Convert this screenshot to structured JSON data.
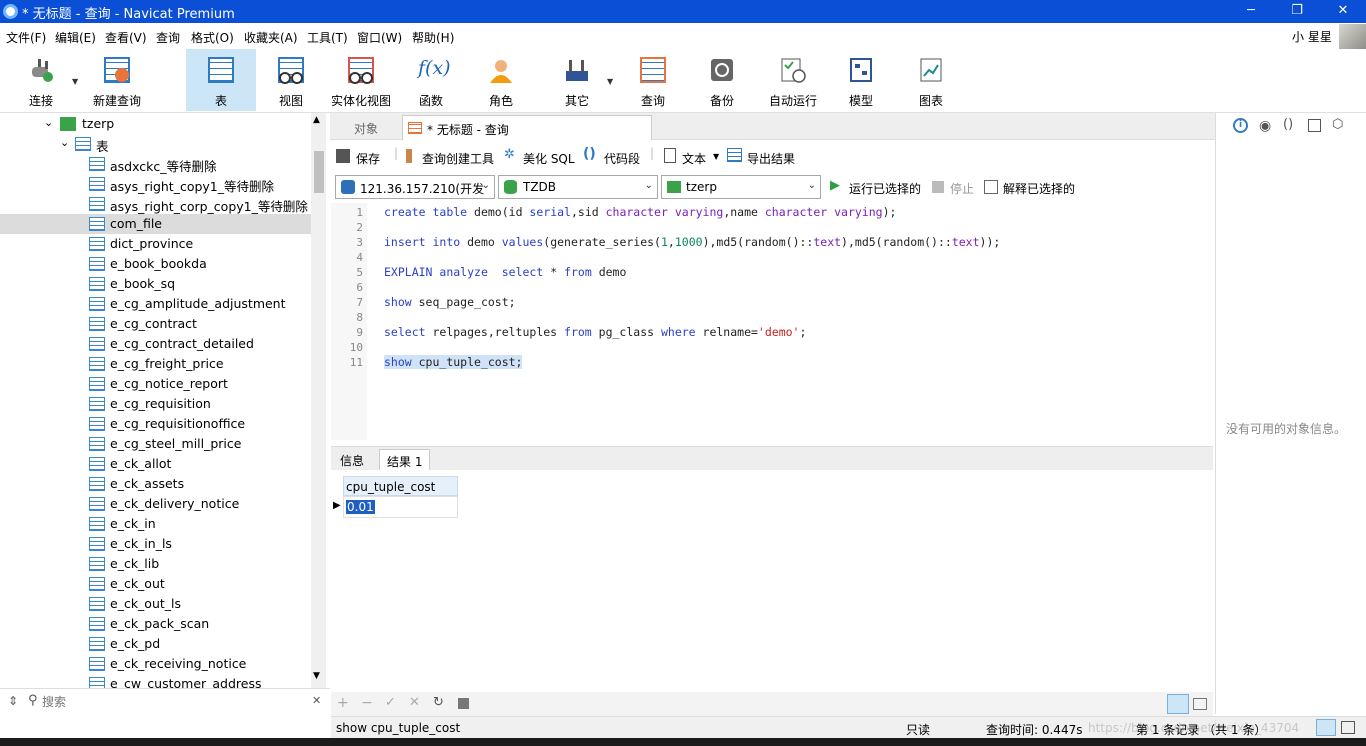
{
  "window": {
    "title": "* 无标题 - 查询 - Navicat Premium",
    "min": "─",
    "max": "❐",
    "close": "✕"
  },
  "menu": [
    "文件(F)",
    "编辑(E)",
    "查看(V)",
    "查询",
    "格式(O)",
    "收藏夹(A)",
    "工具(T)",
    "窗口(W)",
    "帮助(H)"
  ],
  "user": "小 星星",
  "toolbar": [
    {
      "label": "连接",
      "icon": "plug-icon"
    },
    {
      "label": "新建查询",
      "icon": "new-query-icon"
    },
    {
      "label": "表",
      "icon": "table-icon",
      "active": true
    },
    {
      "label": "视图",
      "icon": "view-icon"
    },
    {
      "label": "实体化视图",
      "icon": "materialized-view-icon"
    },
    {
      "label": "函数",
      "icon": "function-icon",
      "glyph": "f(x)"
    },
    {
      "label": "角色",
      "icon": "role-icon"
    },
    {
      "label": "其它",
      "icon": "tools-icon"
    },
    {
      "label": "查询",
      "icon": "query-icon"
    },
    {
      "label": "备份",
      "icon": "backup-icon"
    },
    {
      "label": "自动运行",
      "icon": "automation-icon"
    },
    {
      "label": "模型",
      "icon": "model-icon"
    },
    {
      "label": "图表",
      "icon": "chart-icon"
    }
  ],
  "tree": {
    "db": "tzerp",
    "folder": "表",
    "items": [
      "asdxckc_等待删除",
      "asys_right_copy1_等待删除",
      "asys_right_corp_copy1_等待删除",
      "com_file",
      "dict_province",
      "e_book_bookda",
      "e_book_sq",
      "e_cg_amplitude_adjustment",
      "e_cg_contract",
      "e_cg_contract_detailed",
      "e_cg_freight_price",
      "e_cg_notice_report",
      "e_cg_requisition",
      "e_cg_requisitionoffice",
      "e_cg_steel_mill_price",
      "e_ck_allot",
      "e_ck_assets",
      "e_ck_delivery_notice",
      "e_ck_in",
      "e_ck_in_ls",
      "e_ck_lib",
      "e_ck_out",
      "e_ck_out_ls",
      "e_ck_pack_scan",
      "e_ck_pd",
      "e_ck_receiving_notice",
      "e_cw_customer_address"
    ],
    "selected_index": 3,
    "search_placeholder": "搜索"
  },
  "tabs": {
    "objects": "对象",
    "query": "* 无标题 - 查询"
  },
  "query_toolbar": {
    "save": "保存",
    "builder": "查询创建工具",
    "beautify": "美化 SQL",
    "snippet": "代码段",
    "text": "文本",
    "export": "导出结果"
  },
  "combos": {
    "connection": "121.36.157.210(开发",
    "database": "TZDB",
    "schema": "tzerp"
  },
  "actions": {
    "run_selected": "运行已选择的",
    "stop": "停止",
    "explain_selected": "解释已选择的"
  },
  "editor": {
    "line_numbers": [
      "1",
      "2",
      "3",
      "4",
      "5",
      "6",
      "7",
      "8",
      "9",
      "10",
      "11"
    ],
    "lines": [
      "create table demo(id serial,sid character varying,name character varying);",
      "",
      "insert into demo values(generate_series(1,1000),md5(random()::text),md5(random()::text));",
      "",
      "EXPLAIN analyze  select * from demo",
      "",
      "show seq_page_cost;",
      "",
      "select relpages,reltuples from pg_class where relname='demo';",
      "",
      "show cpu_tuple_cost;"
    ]
  },
  "result_tabs": {
    "info": "信息",
    "result": "结果 1"
  },
  "result": {
    "columns": [
      "cpu_tuple_cost"
    ],
    "rows": [
      [
        "0.01"
      ]
    ]
  },
  "right_panel": {
    "empty": "没有可用的对象信息。"
  },
  "status": {
    "sql": "show cpu_tuple_cost",
    "mode": "只读",
    "time": "查询时间: 0.447s",
    "records": "第 1 条记录 （共 1 条）",
    "watermark": "https://blog.csdn.net/weixin_43704"
  }
}
